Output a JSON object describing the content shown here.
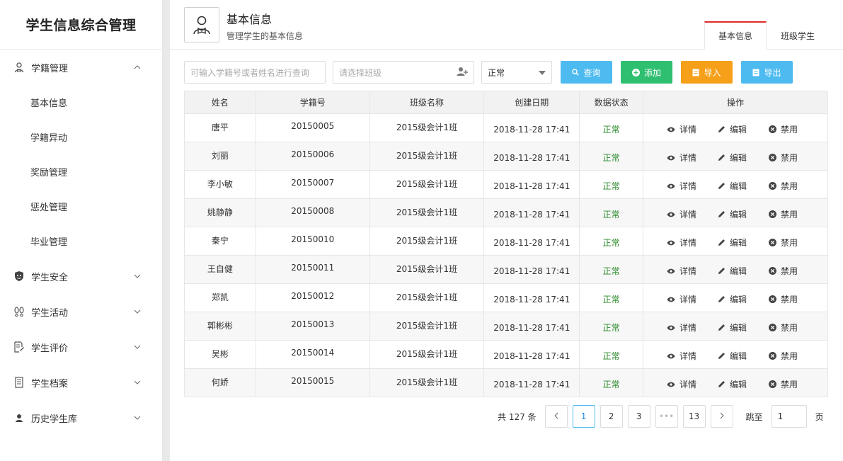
{
  "app": {
    "title": "学生信息综合管理"
  },
  "sidebar": {
    "groups": [
      {
        "label": "学籍管理",
        "icon": "user-icon",
        "expanded": true,
        "items": [
          "基本信息",
          "学籍异动",
          "奖励管理",
          "惩处管理",
          "毕业管理"
        ]
      },
      {
        "label": "学生安全",
        "icon": "shield-icon",
        "expanded": false
      },
      {
        "label": "学生活动",
        "icon": "footprints-icon",
        "expanded": false
      },
      {
        "label": "学生评价",
        "icon": "edit-doc-icon",
        "expanded": false
      },
      {
        "label": "学生档案",
        "icon": "archive-icon",
        "expanded": false
      },
      {
        "label": "历史学生库",
        "icon": "person-icon",
        "expanded": false
      }
    ]
  },
  "header": {
    "title": "基本信息",
    "subtitle": "管理学生的基本信息",
    "tabs": [
      {
        "label": "基本信息",
        "active": true
      },
      {
        "label": "班级学生",
        "active": false
      }
    ]
  },
  "filters": {
    "search_placeholder": "可输入学籍号或者姓名进行查询",
    "class_placeholder": "请选择班级",
    "status_value": "正常",
    "buttons": {
      "query": "查询",
      "add": "添加",
      "import": "导入",
      "export": "导出"
    }
  },
  "table": {
    "headers": [
      "姓名",
      "学籍号",
      "班级名称",
      "创建日期",
      "数据状态",
      "操作"
    ],
    "rows": [
      {
        "name": "唐平",
        "sid": "20150005",
        "cls": "2015级会计1班",
        "date": "2018-11-28 17:41",
        "status": "正常"
      },
      {
        "name": "刘丽",
        "sid": "20150006",
        "cls": "2015级会计1班",
        "date": "2018-11-28 17:41",
        "status": "正常"
      },
      {
        "name": "李小敏",
        "sid": "20150007",
        "cls": "2015级会计1班",
        "date": "2018-11-28 17:41",
        "status": "正常"
      },
      {
        "name": "姚静静",
        "sid": "20150008",
        "cls": "2015级会计1班",
        "date": "2018-11-28 17:41",
        "status": "正常"
      },
      {
        "name": "秦宁",
        "sid": "20150010",
        "cls": "2015级会计1班",
        "date": "2018-11-28 17:41",
        "status": "正常"
      },
      {
        "name": "王自健",
        "sid": "20150011",
        "cls": "2015级会计1班",
        "date": "2018-11-28 17:41",
        "status": "正常"
      },
      {
        "name": "郑凯",
        "sid": "20150012",
        "cls": "2015级会计1班",
        "date": "2018-11-28 17:41",
        "status": "正常"
      },
      {
        "name": "郭彬彬",
        "sid": "20150013",
        "cls": "2015级会计1班",
        "date": "2018-11-28 17:41",
        "status": "正常"
      },
      {
        "name": "吴彬",
        "sid": "20150014",
        "cls": "2015级会计1班",
        "date": "2018-11-28 17:41",
        "status": "正常"
      },
      {
        "name": "何娇",
        "sid": "20150015",
        "cls": "2015级会计1班",
        "date": "2018-11-28 17:41",
        "status": "正常"
      }
    ],
    "actions": {
      "detail": "详情",
      "edit": "编辑",
      "ban": "禁用"
    }
  },
  "pagination": {
    "total_text": "共 127 条",
    "pages": [
      "1",
      "2",
      "3",
      "•••",
      "13"
    ],
    "current": "1",
    "goto_label": "跳至",
    "goto_value": "1",
    "page_suffix": "页"
  },
  "colors": {
    "query": "#4dbbf0",
    "add": "#2fbf71",
    "import": "#f6a019",
    "export": "#4dbbf0",
    "active_tab": "#e02b2b",
    "status_ok": "#2a8a2a"
  }
}
